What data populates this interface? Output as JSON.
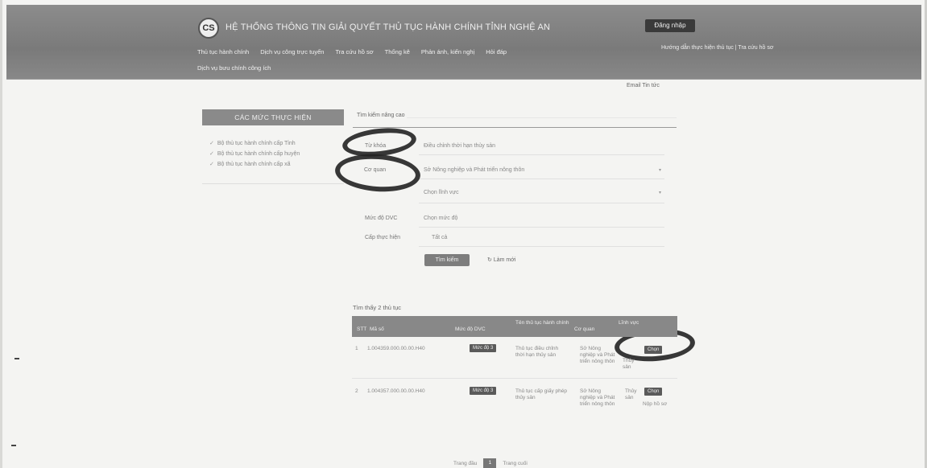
{
  "header": {
    "logo_text": "CS",
    "site_title": "HỆ THỐNG THÔNG TIN GIẢI QUYẾT THỦ TỤC HÀNH CHÍNH TỈNH NGHỆ AN",
    "login_label": "Đăng nhập",
    "links": "Hướng dẫn thực hiện thủ tục  |  Tra cứu hồ sơ",
    "nav": [
      "Thủ tục hành chính",
      "Dịch vụ công trực tuyến",
      "Tra cứu hồ sơ",
      "Thống kê",
      "Phản ánh, kiến nghị",
      "Hỏi đáp"
    ],
    "nav_second_row": "Dịch vụ bưu chính công ích"
  },
  "top_links": "Email   Tin tức",
  "sidebar": {
    "title": "CÁC MỨC THỰC HIỆN",
    "items": [
      "Bộ thủ tục hành chính cấp Tỉnh",
      "Bộ thủ tục hành chính cấp huyện",
      "Bộ thủ tục hành chính cấp xã"
    ]
  },
  "form": {
    "tab": "Tìm kiếm nâng cao",
    "fields": [
      {
        "label": "Từ khóa",
        "value": "Điều chỉnh thời hạn thủy sản"
      },
      {
        "label": "Cơ quan",
        "value": "Sở Nông nghiệp và Phát triển nông thôn"
      },
      {
        "label": "",
        "value": "Chọn lĩnh vực"
      },
      {
        "label": "Mức độ DVC",
        "value": "Chọn mức độ"
      },
      {
        "label": "Cấp thực hiện",
        "value": "Tất cả"
      }
    ],
    "search_label": "Tìm kiếm",
    "reset_label": "Làm mới"
  },
  "results": {
    "title": "Tìm thấy 2 thủ tục",
    "columns": [
      "STT",
      "Mã số",
      "Mức độ DVC",
      "Tên thủ tục hành chính",
      "Cơ quan",
      "Lĩnh vực"
    ],
    "rows": [
      {
        "stt": "1",
        "code": "1.004359.000.00.00.H40",
        "level": "Mức độ 3",
        "name": "Thủ tục điều chỉnh thời hạn thủy sản",
        "agency": "Sở Nông nghiệp và Phát triển nông thôn",
        "field": "Thủy sản",
        "action": "Chọn"
      },
      {
        "stt": "2",
        "code": "1.004357.000.00.00.H40",
        "level": "Mức độ 3",
        "name": "Thủ tục cấp giấy phép thủy sản",
        "agency": "Sở Nông nghiệp và Phát triển nông thôn",
        "field": "Thủy sản",
        "action": "Chọn",
        "extra": "Nộp hồ sơ"
      }
    ]
  },
  "pagination": {
    "prev": "Trang đầu",
    "current": "1",
    "next": "Trang cuối"
  },
  "colors": {
    "header_bg": "#808080",
    "accent_dark": "#3a3a3a",
    "badge": "#5a5a5a"
  }
}
